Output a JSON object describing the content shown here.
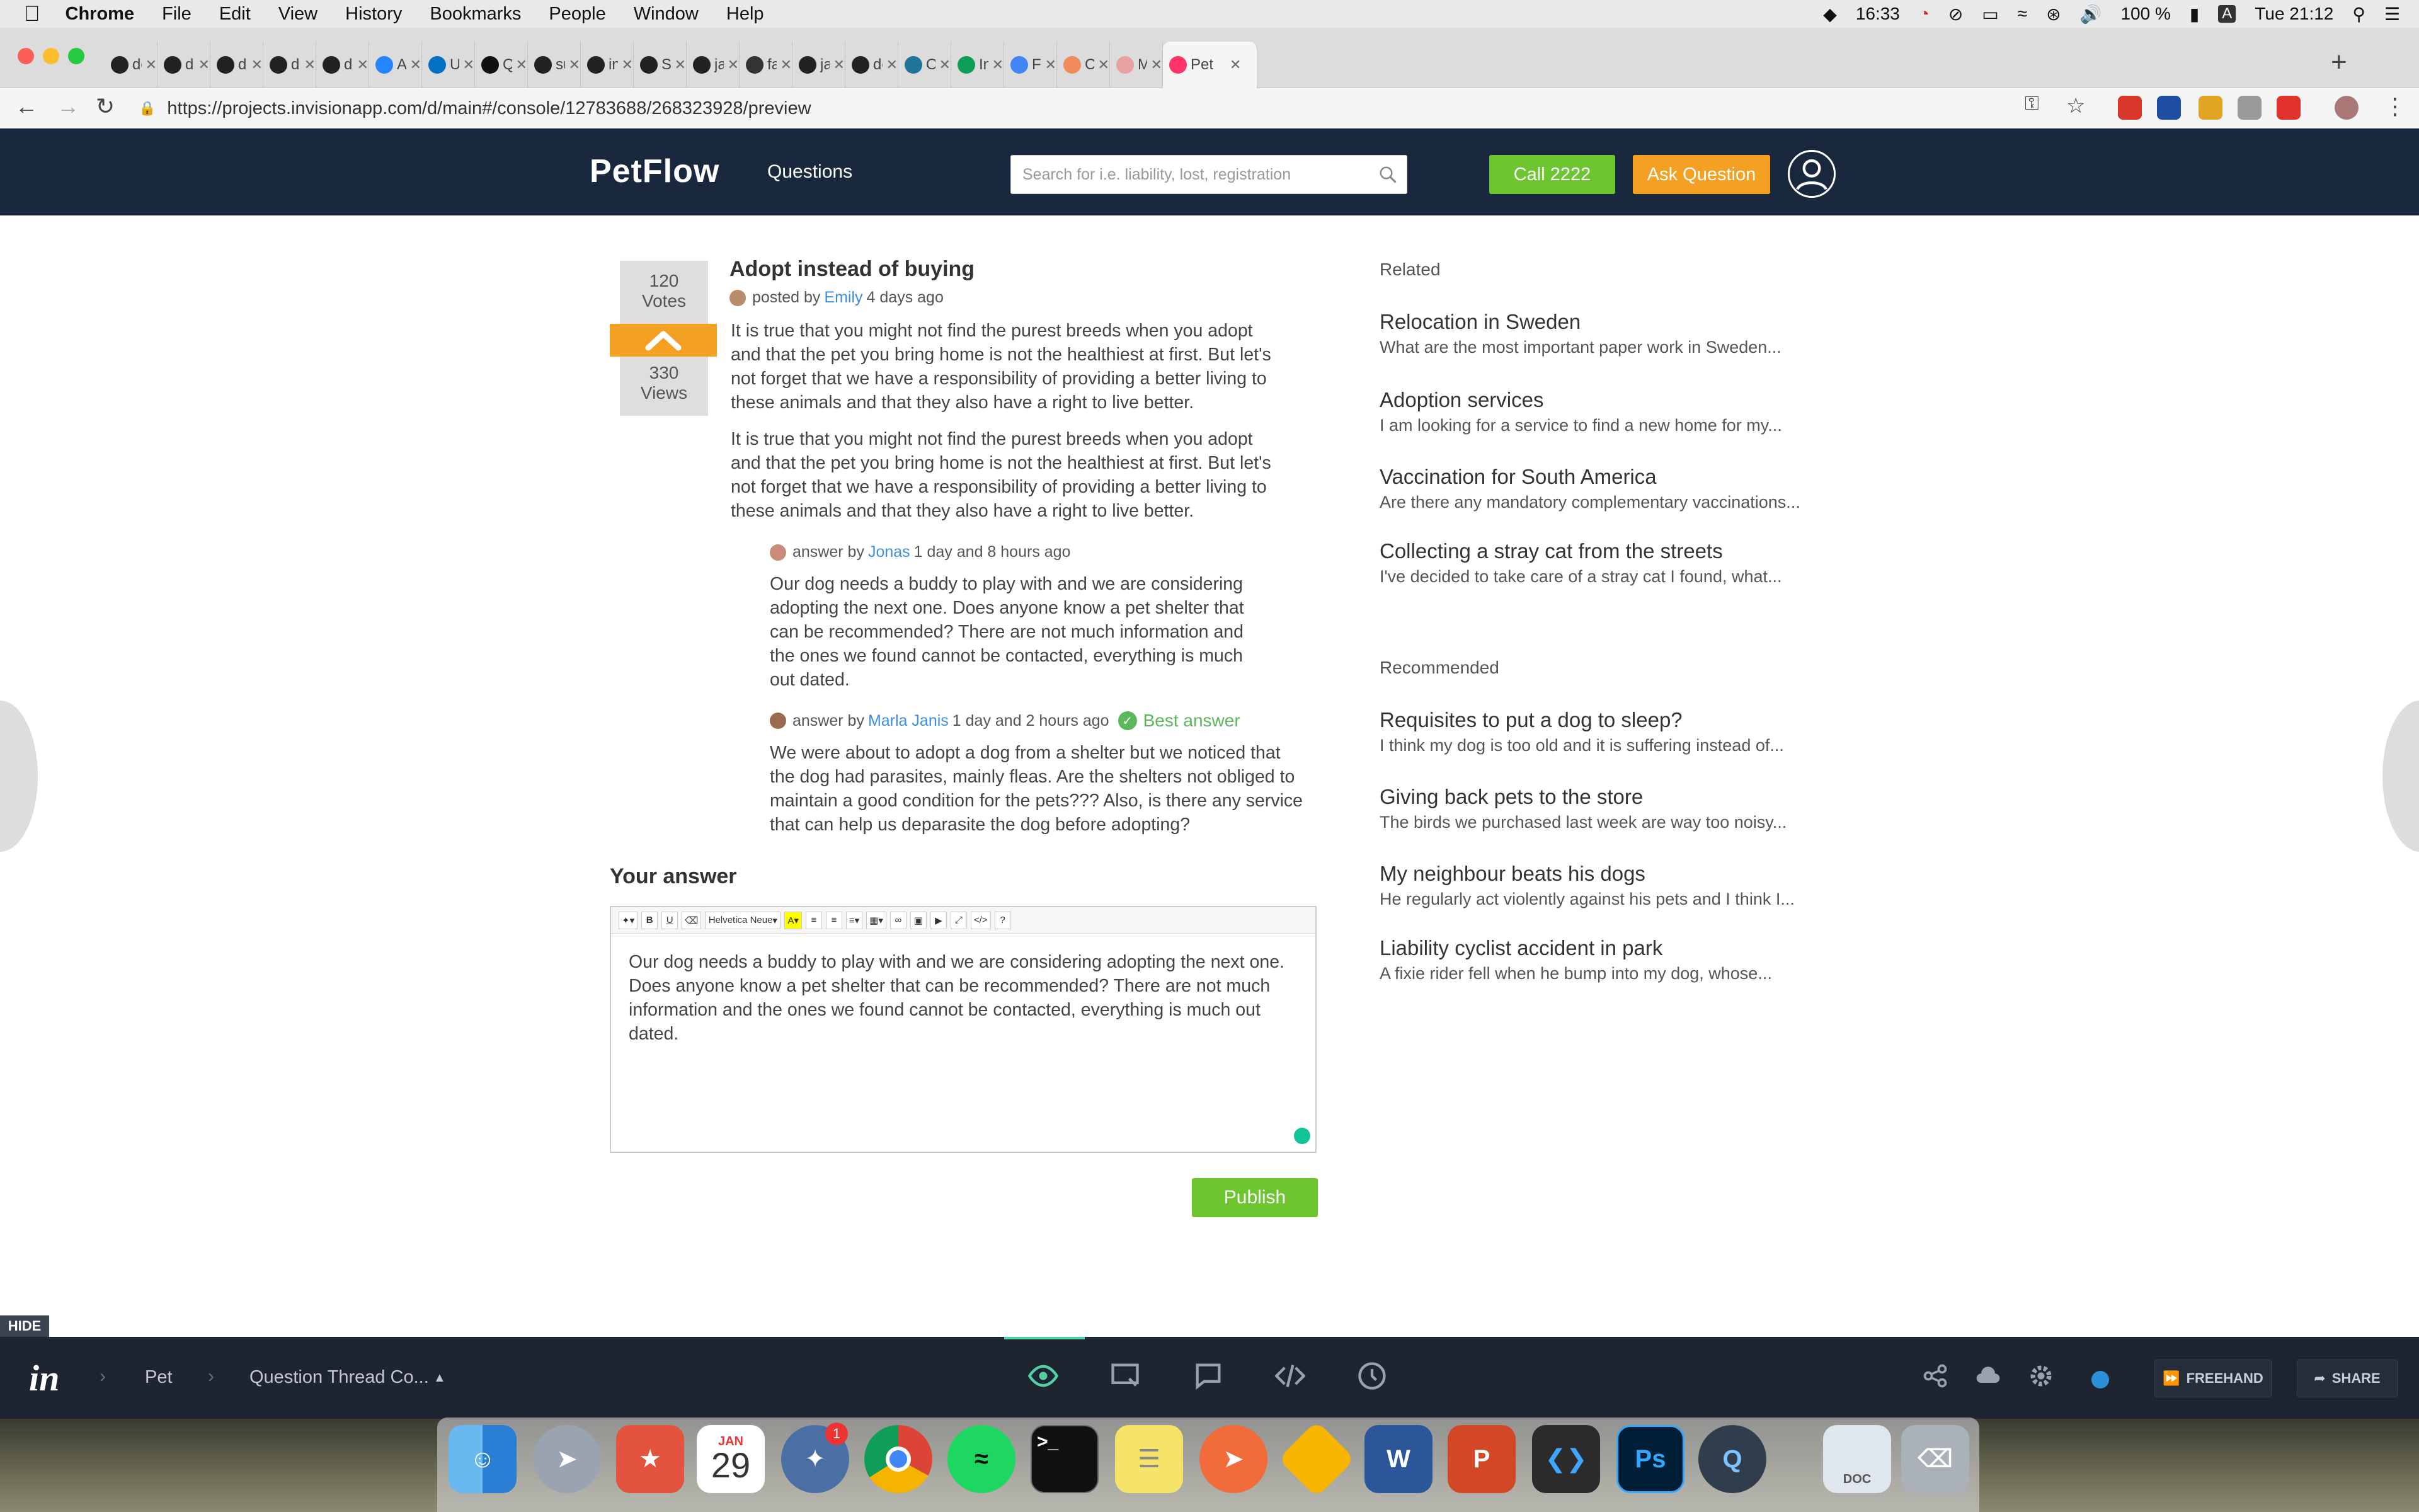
{
  "menubar": {
    "app": "Chrome",
    "items": [
      "File",
      "Edit",
      "View",
      "History",
      "Bookmarks",
      "People",
      "Window",
      "Help"
    ],
    "time": "16:33",
    "battery": "100 %",
    "input": "A",
    "clock": "Tue 21:12"
  },
  "tabs": [
    {
      "title": "dor",
      "icon": "github-icon"
    },
    {
      "title": "dial",
      "icon": "github-icon"
    },
    {
      "title": "dial",
      "icon": "github-icon"
    },
    {
      "title": "dial",
      "icon": "github-icon"
    },
    {
      "title": "dial",
      "icon": "github-icon"
    },
    {
      "title": "A Ju",
      "icon": "atlassian-icon"
    },
    {
      "title": "Usi",
      "icon": "intel-icon"
    },
    {
      "title": "Que",
      "icon": "medium-icon"
    },
    {
      "title": "sun",
      "icon": "github-icon"
    },
    {
      "title": "indi",
      "icon": "github-icon"
    },
    {
      "title": "Sea",
      "icon": "github-icon"
    },
    {
      "title": "jaci",
      "icon": "github-icon"
    },
    {
      "title": "fan",
      "icon": "stack-icon"
    },
    {
      "title": "jaci",
      "icon": "github-icon"
    },
    {
      "title": "def",
      "icon": "github-icon"
    },
    {
      "title": "Ope",
      "icon": "wordpress-icon"
    },
    {
      "title": "Inte",
      "icon": "sheets-icon"
    },
    {
      "title": "Fin",
      "icon": "docs-icon"
    },
    {
      "title": "Chi",
      "icon": "orange-icon"
    },
    {
      "title": "Me",
      "icon": "pink-icon"
    },
    {
      "title": "Pet",
      "icon": "invision-icon"
    }
  ],
  "address": {
    "url": "https://projects.invisionapp.com/d/main#/console/12783688/268323928/preview"
  },
  "header": {
    "logo": "PetFlow",
    "nav_questions": "Questions",
    "search_placeholder": "Search for i.e. liability, lost, registration",
    "call_label": "Call 2222",
    "ask_label": "Ask Question"
  },
  "question": {
    "votes": "120",
    "votes_label": "Votes",
    "views": "330",
    "views_label": "Views",
    "title": "Adopt instead of buying",
    "posted_by": "posted by",
    "author": "Emily",
    "time": "4 days ago",
    "body": [
      "It is true that you might not find the purest breeds when you adopt and that the pet you bring home is not the healthiest at first. But let's not forget that we have a responsibility of providing a better living to these animals and that they also have a right to live better.",
      "It is true that you might not find the purest breeds when you adopt and that the pet you bring home is not the healthiest at first. But let's not forget that we have a responsibility of providing a better living to these animals and that they also have a right to live better."
    ]
  },
  "answers": [
    {
      "prefix": "answer by",
      "author": "Jonas",
      "time": "1 day and 8 hours ago",
      "best": "",
      "body": "Our dog needs a buddy to play with and we are considering adopting the next one. Does anyone know a pet shelter that can be recommended? There are not much information and the ones we found cannot be contacted, everything is much out dated."
    },
    {
      "prefix": "answer by",
      "author": "Marla Janis",
      "time": "1 day and 2 hours ago",
      "best": "Best answer",
      "body": "We were about to adopt a dog from a shelter but we noticed that the dog had parasites, mainly fleas. Are the shelters not obliged to maintain a good condition for the pets??? Also, is there any service that can help us deparasite the dog before adopting?"
    }
  ],
  "your_answer": {
    "heading": "Your answer",
    "font_select": "Helvetica Neue",
    "text": "Our dog needs a buddy to play with and we are considering adopting the next one. Does anyone know a pet shelter that can be recommended? There are not much information and the ones we found cannot be contacted, everything is much out dated.",
    "publish": "Publish"
  },
  "sidebar": {
    "related_heading": "Related",
    "related": [
      {
        "title": "Relocation in Sweden",
        "snippet": "What are the most important paper work in Sweden..."
      },
      {
        "title": "Adoption services",
        "snippet": "I am looking for a service to find a new home for my..."
      },
      {
        "title": "Vaccination for South America",
        "snippet": "Are there any mandatory complementary vaccinations..."
      },
      {
        "title": "Collecting a stray cat from the streets",
        "snippet": "I've decided to take care of a stray cat I found, what..."
      }
    ],
    "recommended_heading": "Recommended",
    "recommended": [
      {
        "title": "Requisites to put a dog to sleep?",
        "snippet": "I think my dog is too old and it is suffering instead of..."
      },
      {
        "title": "Giving back pets to the store",
        "snippet": "The birds we purchased last week are way too noisy..."
      },
      {
        "title": "My neighbour beats his dogs",
        "snippet": "He regularly act violently against his pets and I think I..."
      },
      {
        "title": "Liability cyclist accident in park",
        "snippet": "A fixie rider fell when he bump into my dog, whose..."
      }
    ]
  },
  "invision": {
    "hide": "HIDE",
    "logo": "in",
    "crumb_project": "Pet",
    "crumb_screen": "Question Thread Co...",
    "freehand": "FREEHAND",
    "share": "SHARE"
  },
  "dock": {
    "calendar_month": "JAN",
    "calendar_day": "29",
    "badge": "1",
    "terminal": ">_",
    "word": "W",
    "ps": "Ps",
    "doc": "DOC"
  },
  "colors": {
    "header_bg": "#19283d",
    "green": "#6dc62f",
    "orange": "#f4a022",
    "link": "#3d8ee0",
    "best": "#5cb85c"
  }
}
